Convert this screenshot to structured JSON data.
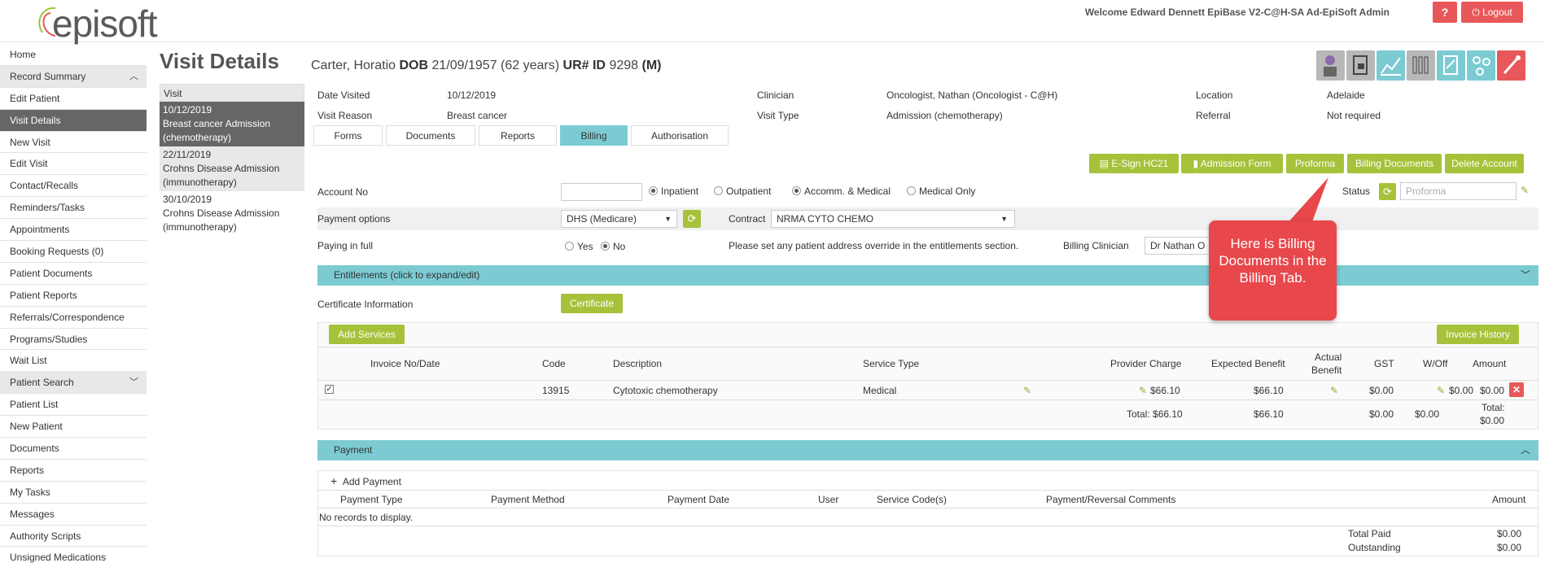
{
  "header": {
    "logo": "episoft",
    "welcome": "Welcome Edward Dennett EpiBase V2-C@H-SA Ad-EpiSoft Admin",
    "help_label": "?",
    "logout_label": "Logout",
    "accent": "#e8585a"
  },
  "sidebar": {
    "items": [
      {
        "label": "Home"
      },
      {
        "label": "Record Summary"
      },
      {
        "label": "Edit Patient"
      },
      {
        "label": "Visit Details"
      },
      {
        "label": "New Visit"
      },
      {
        "label": "Edit Visit"
      },
      {
        "label": "Contact/Recalls"
      },
      {
        "label": "Reminders/Tasks"
      },
      {
        "label": "Appointments"
      },
      {
        "label": "Booking Requests (0)"
      },
      {
        "label": "Patient Documents"
      },
      {
        "label": "Patient Reports"
      },
      {
        "label": "Referrals/Correspondence"
      },
      {
        "label": "Programs/Studies"
      },
      {
        "label": "Wait List"
      },
      {
        "label": "Patient Search"
      },
      {
        "label": "Patient List"
      },
      {
        "label": "New Patient"
      },
      {
        "label": "Documents"
      },
      {
        "label": "Reports"
      },
      {
        "label": "My Tasks"
      },
      {
        "label": "Messages"
      },
      {
        "label": "Authority Scripts"
      },
      {
        "label": "Unsigned Medications"
      }
    ]
  },
  "page": {
    "title": "Visit Details",
    "patient_name": "Carter, Horatio",
    "dob_label": "DOB",
    "dob_value": "21/09/1957 (62 years)",
    "ur_label": "UR#",
    "id_label": "ID",
    "id_value": "9298",
    "sex": "(M)"
  },
  "visits": {
    "header": "Visit",
    "entries": [
      {
        "date": "10/12/2019",
        "text": "Breast cancer   Admission (chemotherapy)"
      },
      {
        "date": "22/11/2019",
        "text": "Crohns Disease   Admission (immunotherapy)"
      },
      {
        "date": "30/10/2019",
        "text": "Crohns Disease   Admission (immunotherapy)"
      }
    ]
  },
  "visit_info": {
    "date_visited_label": "Date Visited",
    "date_visited": "10/12/2019",
    "visit_reason_label": "Visit Reason",
    "visit_reason": "Breast cancer",
    "clinician_label": "Clinician",
    "clinician": "Oncologist, Nathan (Oncologist - C@H)",
    "visit_type_label": "Visit Type",
    "visit_type": "Admission (chemotherapy)",
    "location_label": "Location",
    "location": "Adelaide",
    "referral_label": "Referral",
    "referral": "Not required"
  },
  "tabs": [
    "Forms",
    "Documents",
    "Reports",
    "Billing",
    "Authorisation"
  ],
  "actions": {
    "esign": "E-Sign HC21",
    "admission_form": "Admission Form",
    "proforma": "Proforma",
    "billing_documents": "Billing Documents",
    "delete_account": "Delete Account"
  },
  "billing": {
    "account_no_label": "Account No",
    "inpatient": "Inpatient",
    "outpatient": "Outpatient",
    "accomm_medical": "Accomm. & Medical",
    "medical_only": "Medical Only",
    "status_label": "Status",
    "status_placeholder": "Proforma",
    "payment_options_label": "Payment options",
    "payment_option": "DHS (Medicare)",
    "contract_label": "Contract",
    "contract": "NRMA CYTO CHEMO",
    "paying_in_full_label": "Paying in full",
    "yes": "Yes",
    "no": "No",
    "address_note": "Please set any patient address override in the entitlements section.",
    "billing_clinician_label": "Billing Clinician",
    "billing_clinician": "Dr Nathan O",
    "entitlements": "Entitlements (click to expand/edit)",
    "certificate_label": "Certificate Information",
    "certificate_btn": "Certificate"
  },
  "services": {
    "add_services": "Add Services",
    "invoice_history": "Invoice History",
    "headers": {
      "invoice": "Invoice No/Date",
      "code": "Code",
      "description": "Description",
      "service_type": "Service Type",
      "provider_charge": "Provider Charge",
      "expected_benefit": "Expected Benefit",
      "actual_benefit_1": "Actual",
      "actual_benefit_2": "Benefit",
      "gst": "GST",
      "woff": "W/Off",
      "amount": "Amount"
    },
    "row": {
      "code": "13915",
      "description": "Cytotoxic chemotherapy",
      "service_type": "Medical",
      "provider_charge": "$66.10",
      "expected_benefit": "$66.10",
      "gst": "$0.00",
      "woff": "$0.00",
      "amount": "$0.00"
    },
    "totals": {
      "provider_charge": "Total: $66.10",
      "expected_benefit": "$66.10",
      "gst": "$0.00",
      "woff": "$0.00",
      "amount_1": "Total:",
      "amount_2": "$0.00"
    }
  },
  "payment": {
    "title": "Payment",
    "add_payment": "Add Payment",
    "headers": {
      "type": "Payment Type",
      "method": "Payment Method",
      "date": "Payment Date",
      "user": "User",
      "codes": "Service Code(s)",
      "comments": "Payment/Reversal Comments",
      "amount": "Amount"
    },
    "empty": "No records to display.",
    "total_paid_label": "Total Paid",
    "total_paid": "$0.00",
    "outstanding_label": "Outstanding",
    "outstanding": "$0.00"
  },
  "callout": {
    "text": "Here is Billing Documents in the Billing Tab."
  },
  "colors": {
    "teal": "#7ccbd3",
    "green": "#a6c23a",
    "red": "#e8585a"
  }
}
